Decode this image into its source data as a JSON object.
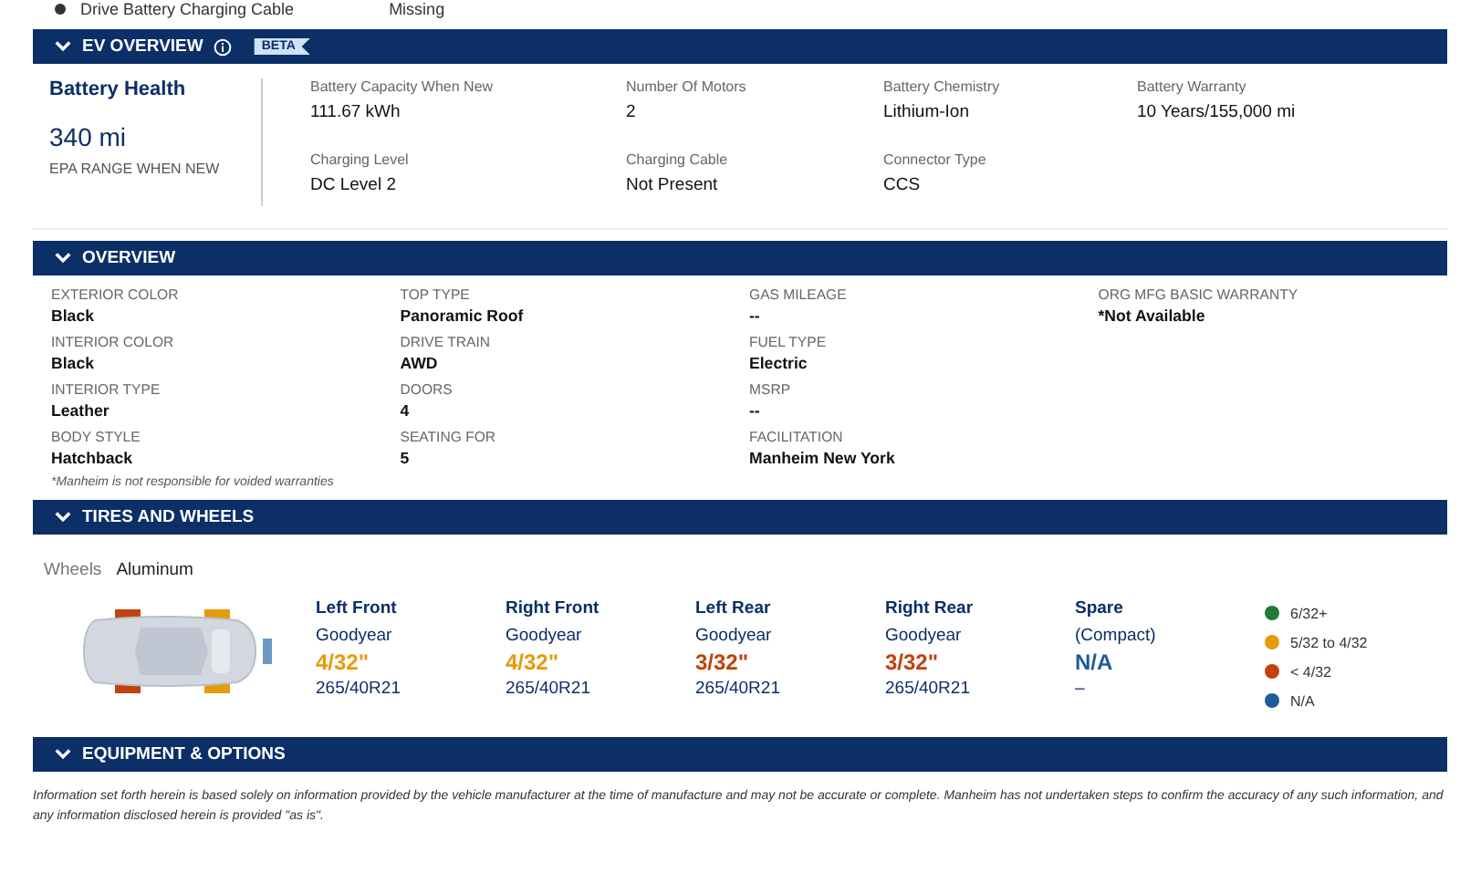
{
  "top_row": {
    "label": "Drive Battery Charging Cable",
    "value": "Missing"
  },
  "ev_overview": {
    "title": "EV OVERVIEW",
    "badge": "BETA",
    "battery_health": {
      "title": "Battery Health",
      "value": "340 mi",
      "caption": "EPA RANGE WHEN NEW"
    },
    "rows": [
      [
        {
          "label": "Battery Capacity When New",
          "value": "111.67 kWh"
        },
        {
          "label": "Number Of Motors",
          "value": "2"
        },
        {
          "label": "Battery Chemistry",
          "value": "Lithium-Ion"
        },
        {
          "label": "Battery Warranty",
          "value": "10 Years/155,000 mi"
        }
      ],
      [
        {
          "label": "Charging Level",
          "value": "DC Level 2"
        },
        {
          "label": "Charging Cable",
          "value": "Not Present"
        },
        {
          "label": "Connector Type",
          "value": "CCS"
        }
      ]
    ]
  },
  "overview": {
    "title": "OVERVIEW",
    "columns": [
      [
        {
          "label": "EXTERIOR COLOR",
          "value": "Black"
        },
        {
          "label": "INTERIOR COLOR",
          "value": "Black"
        },
        {
          "label": "INTERIOR TYPE",
          "value": "Leather"
        },
        {
          "label": "BODY STYLE",
          "value": "Hatchback"
        }
      ],
      [
        {
          "label": "TOP TYPE",
          "value": "Panoramic Roof"
        },
        {
          "label": "DRIVE TRAIN",
          "value": "AWD"
        },
        {
          "label": "DOORS",
          "value": "4"
        },
        {
          "label": "SEATING FOR",
          "value": "5"
        }
      ],
      [
        {
          "label": "GAS MILEAGE",
          "value": "--"
        },
        {
          "label": "FUEL TYPE",
          "value": "Electric"
        },
        {
          "label": "MSRP",
          "value": "--"
        },
        {
          "label": "FACILITATION",
          "value": "Manheim New York"
        }
      ],
      [
        {
          "label": "ORG MFG BASIC WARRANTY",
          "value": "*Not Available"
        }
      ]
    ],
    "footnote": "*Manheim is not responsible for voided warranties"
  },
  "tires_and_wheels": {
    "title": "TIRES AND WHEELS",
    "wheels_label": "Wheels",
    "wheels_value": "Aluminum",
    "tires": [
      {
        "position": "Left Front",
        "brand": "Goodyear",
        "tread": "4/32\"",
        "color": "#e59b0c",
        "size": "265/40R21"
      },
      {
        "position": "Right Front",
        "brand": "Goodyear",
        "tread": "4/32\"",
        "color": "#e59b0c",
        "size": "265/40R21"
      },
      {
        "position": "Left Rear",
        "brand": "Goodyear",
        "tread": "3/32\"",
        "color": "#c2410c",
        "size": "265/40R21"
      },
      {
        "position": "Right Rear",
        "brand": "Goodyear",
        "tread": "3/32\"",
        "color": "#c2410c",
        "size": "265/40R21"
      },
      {
        "position": "Spare",
        "brand": "(Compact)",
        "tread": "N/A",
        "color": "#1f5c99",
        "size": "–"
      }
    ],
    "legend": [
      {
        "label": "6/32+",
        "color": "#1e7b3c"
      },
      {
        "label": "5/32 to 4/32",
        "color": "#e59b0c"
      },
      {
        "label": "< 4/32",
        "color": "#c2410c"
      },
      {
        "label": "N/A",
        "color": "#1f5c99"
      }
    ]
  },
  "equipment": {
    "title": "EQUIPMENT & OPTIONS",
    "disclaimer": "Information set forth herein is based solely on information provided by the vehicle manufacturer at the time of manufacture and may not be accurate or complete. Manheim has not undertaken steps to confirm the accuracy of any such information, and any information disclosed herein is provided \"as is\"."
  }
}
